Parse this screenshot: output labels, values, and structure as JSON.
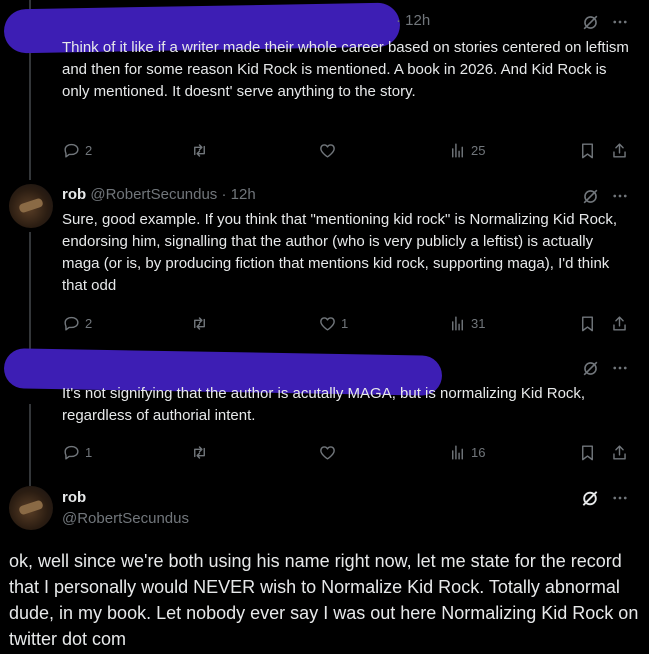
{
  "tweets": [
    {
      "name": "",
      "handle": "",
      "time": "· 12h",
      "text": "Think of it like if a writer made their whole career based on stories centered on leftism and then for some reason Kid Rock is mentioned. A book in 2026. And Kid Rock is only mentioned. It doesnt' serve anything to the story.",
      "replies": "2",
      "retweets": "",
      "likes": "",
      "views": "25"
    },
    {
      "name": "rob",
      "handle": "@RobertSecundus",
      "time": "· 12h",
      "text": "Sure, good example. If you think that \"mentioning kid rock\" is Normalizing Kid Rock, endorsing him, signalling that the author (who is very publicly a leftist) is actually maga (or is, by producing fiction that mentions kid rock, supporting maga), I'd think that odd",
      "replies": "2",
      "retweets": "",
      "likes": "1",
      "views": "31"
    },
    {
      "name": "",
      "handle": "",
      "time": "",
      "text": "It's not signifying that the author is acutally MAGA, but is normalizing Kid Rock, regardless of authorial intent.",
      "replies": "1",
      "retweets": "",
      "likes": "",
      "views": "16"
    }
  ],
  "focused": {
    "name": "rob",
    "handle": "@RobertSecundus",
    "text": "ok, well since we're both using his name right now, let me state for the record that I personally would NEVER wish to Normalize Kid Rock. Totally abnormal dude, in my book. Let nobody ever say I was out here Normalizing Kid Rock on twitter dot com"
  },
  "colors": {
    "redaction": "#3d1eb4",
    "muted": "#71767b",
    "text": "#e7e9ea"
  },
  "icons": [
    "grok-icon",
    "more-icon",
    "reply-icon",
    "retweet-icon",
    "like-icon",
    "views-icon",
    "bookmark-icon",
    "share-icon"
  ]
}
